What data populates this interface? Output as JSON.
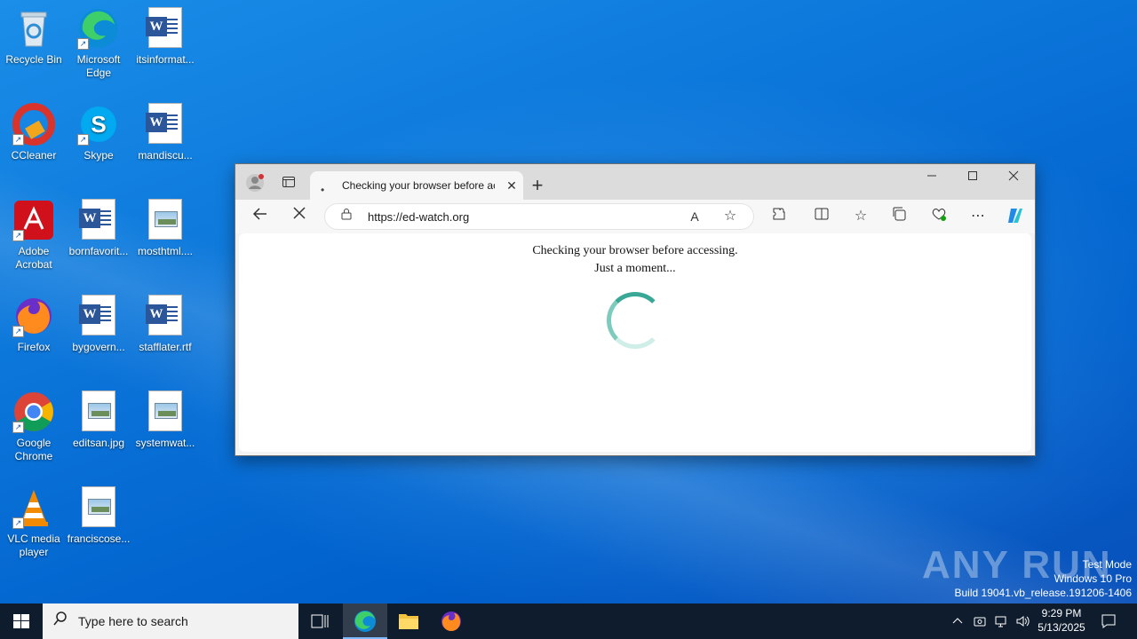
{
  "desktop": {
    "icons": [
      {
        "label": "Recycle Bin"
      },
      {
        "label": "Microsoft Edge"
      },
      {
        "label": "itsinformat..."
      },
      {
        "label": "CCleaner"
      },
      {
        "label": "Skype"
      },
      {
        "label": "mandiscu..."
      },
      {
        "label": "Adobe Acrobat"
      },
      {
        "label": "bornfavorit..."
      },
      {
        "label": "mosthtml...."
      },
      {
        "label": "Firefox"
      },
      {
        "label": "bygovern..."
      },
      {
        "label": "stafflater.rtf"
      },
      {
        "label": "Google Chrome"
      },
      {
        "label": "editsan.jpg"
      },
      {
        "label": "systemwat..."
      },
      {
        "label": "VLC media player"
      },
      {
        "label": "franciscose..."
      }
    ]
  },
  "browser": {
    "tab_title": "Checking your browser before accessing",
    "url": "https://ed-watch.org",
    "page_line1": "Checking your browser before accessing.",
    "page_line2": "Just a moment...",
    "colors": {
      "spinner": "#3aa896",
      "accent": "#0078d4"
    }
  },
  "taskbar": {
    "search_placeholder": "Type here to search",
    "time": "9:29 PM",
    "date": "5/13/2025"
  },
  "watermark": {
    "line1": "Test Mode",
    "line2": "Windows 10 Pro",
    "line3": "Build 19041.vb_release.191206-1406",
    "brand": "ANY RUN"
  }
}
